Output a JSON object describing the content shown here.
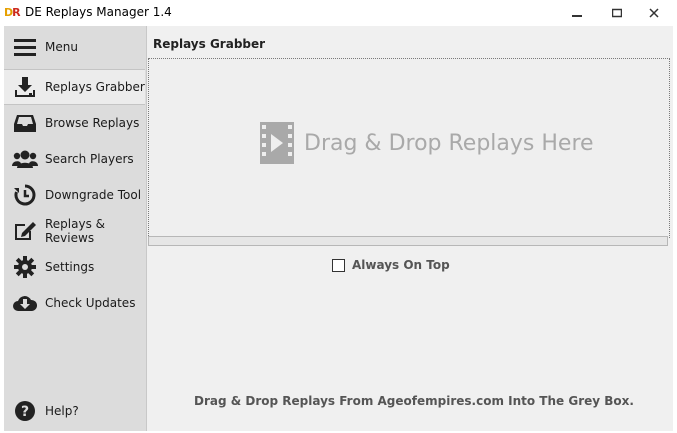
{
  "window": {
    "title": "DE Replays Manager 1.4",
    "app_icon_letters": {
      "d": "D",
      "r": "R"
    }
  },
  "sidebar": {
    "items": [
      {
        "label": "Menu",
        "icon": "hamburger-menu-icon"
      },
      {
        "label": "Replays Grabber",
        "icon": "download-tray-icon",
        "active": true
      },
      {
        "label": "Browse Replays",
        "icon": "inbox-tray-icon"
      },
      {
        "label": "Search Players",
        "icon": "users-group-icon"
      },
      {
        "label": "Downgrade Tool",
        "icon": "history-clock-icon"
      },
      {
        "label": "Replays & Reviews",
        "icon": "edit-pencil-icon"
      },
      {
        "label": "Settings",
        "icon": "gear-icon"
      },
      {
        "label": "Check Updates",
        "icon": "cloud-download-icon"
      },
      {
        "label": "Help?",
        "icon": "question-circle-icon"
      }
    ]
  },
  "main": {
    "title": "Replays Grabber",
    "drop_zone_text": "Drag & Drop Replays Here",
    "progress": 0,
    "always_on_top": {
      "label": "Always On Top",
      "checked": false
    },
    "footer_hint": "Drag & Drop Replays From Ageofempires.com Into The Grey Box."
  },
  "colors": {
    "sidebar_bg": "#dcdcdc",
    "active_item_bg": "#ececec",
    "main_bg": "#f0f0f0",
    "drop_text": "#a9a9a9"
  }
}
